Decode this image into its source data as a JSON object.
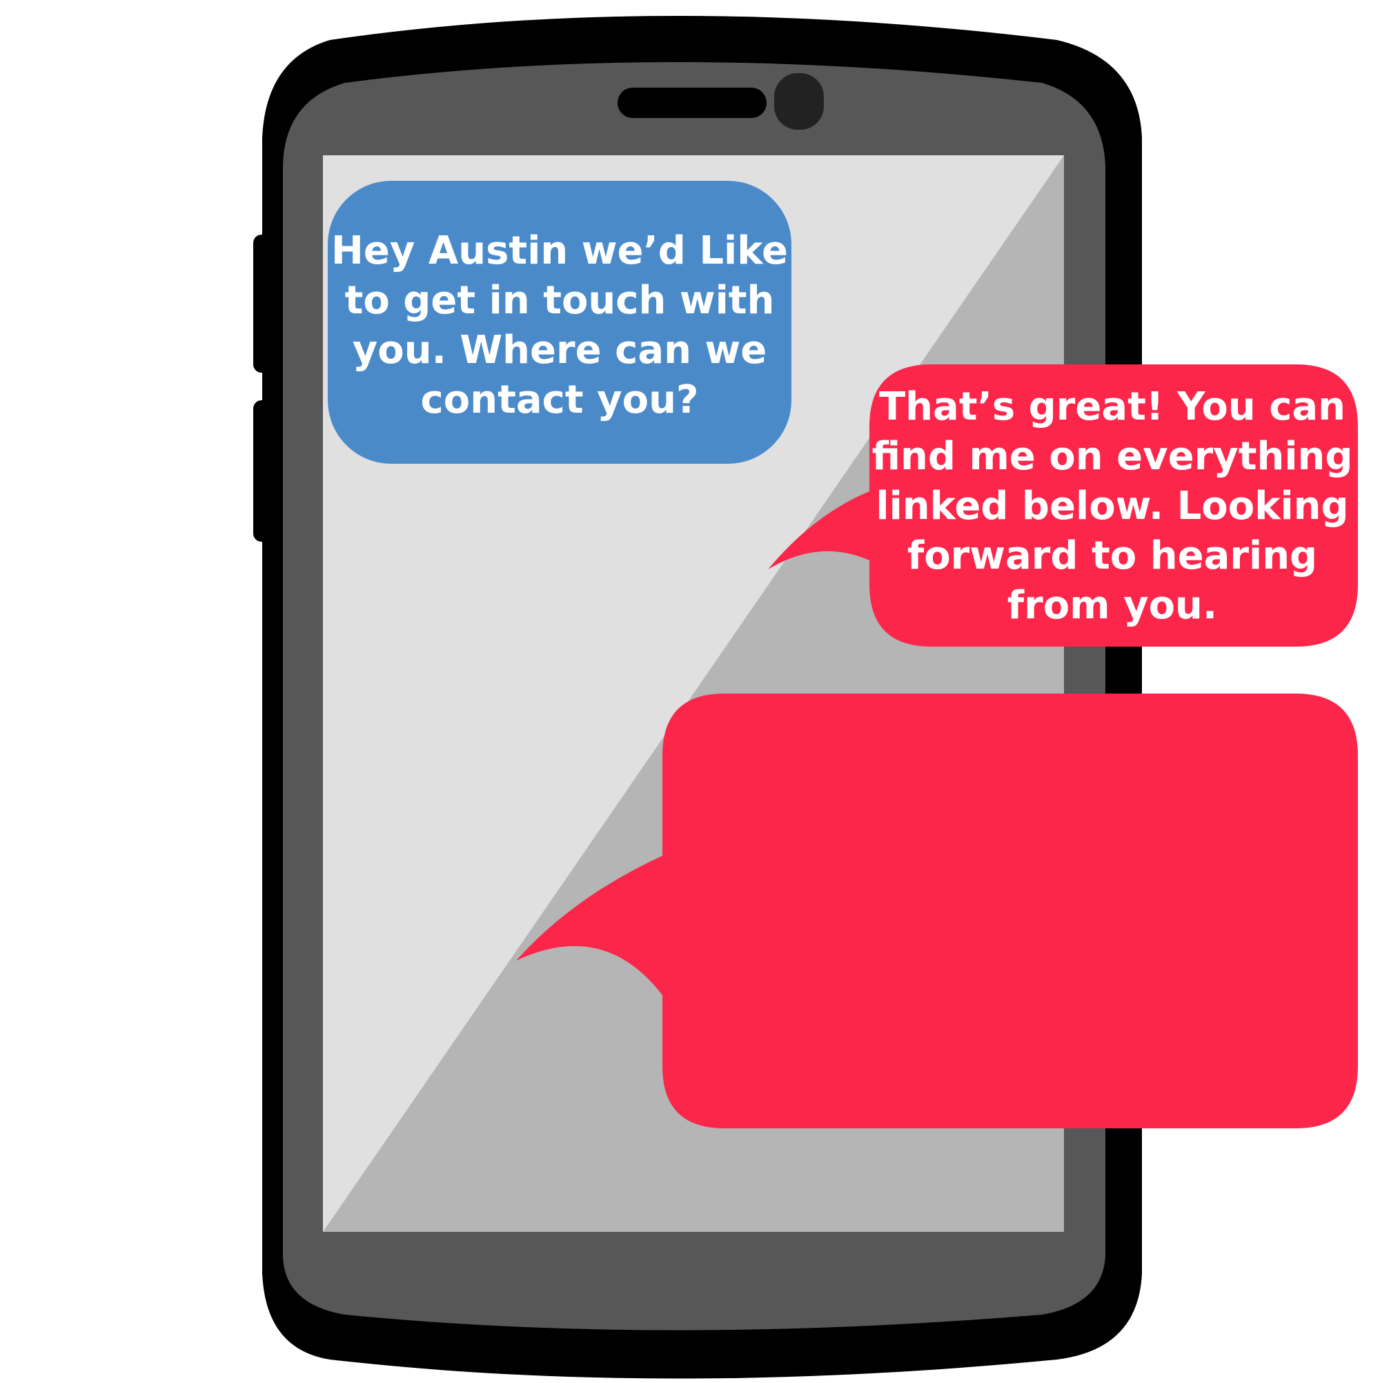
{
  "colors": {
    "phone_outline": "#000000",
    "phone_body": "#575757",
    "screen_light": "#e0e0e0",
    "screen_shadow": "#b5b5b5",
    "speaker": "#000000",
    "camera": "#222222",
    "incoming_bubble": "#4a8ac9",
    "reply_bubble": "#fb264a",
    "bubble_text": "#ffffff"
  },
  "phone": {
    "speaker_icon": "speaker-grille-icon",
    "camera_icon": "front-camera-icon"
  },
  "messages": {
    "incoming": {
      "lines": [
        "Hey Austin we’d Like",
        "to get in touch with",
        "you. Where can we",
        "contact you?"
      ]
    },
    "reply": {
      "lines": [
        "That’s great! You can",
        "find me on everything",
        "linked below. Looking",
        "forward to hearing",
        "from you."
      ]
    }
  }
}
